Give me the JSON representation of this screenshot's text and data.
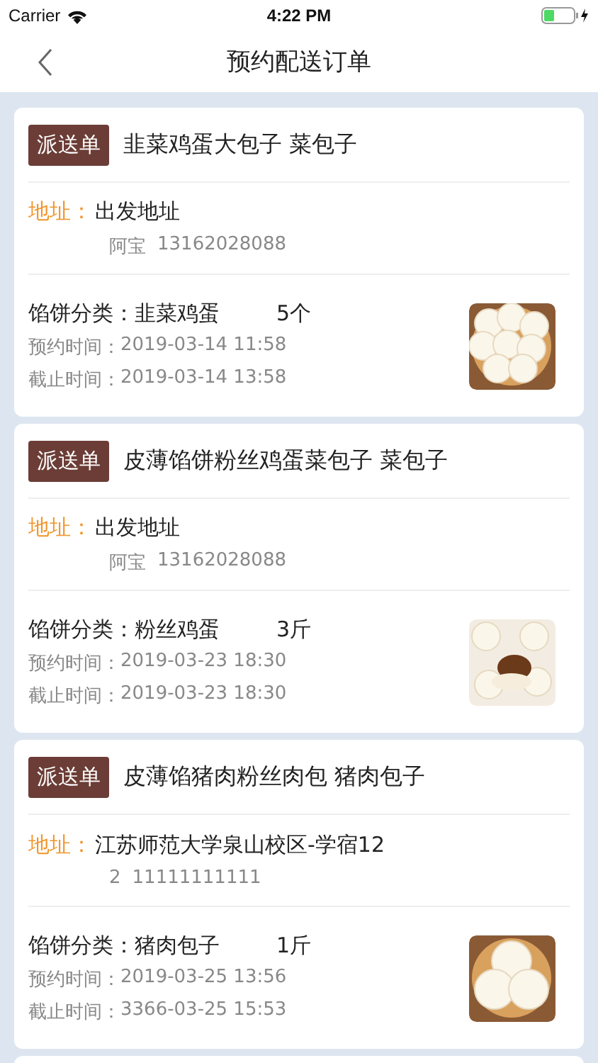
{
  "status_bar": {
    "carrier": "Carrier",
    "time": "4:22 PM"
  },
  "nav": {
    "title": "预约配送订单"
  },
  "orders": [
    {
      "tag": "派送单",
      "title": "韭菜鸡蛋大包子 菜包子",
      "address_label": "地址：",
      "address": "出发地址",
      "contact": "阿宝",
      "phone": "13162028088",
      "filling_label": "馅饼分类：",
      "filling": "韭菜鸡蛋",
      "quantity": "5个",
      "booking_label": "预约时间：",
      "booking_time": "2019-03-14 11:58",
      "deadline_label": "截止时间：",
      "deadline_time": "2019-03-14 13:58"
    },
    {
      "tag": "派送单",
      "title": "皮薄馅饼粉丝鸡蛋菜包子 菜包子",
      "address_label": "地址：",
      "address": "出发地址",
      "contact": "阿宝",
      "phone": "13162028088",
      "filling_label": "馅饼分类：",
      "filling": "粉丝鸡蛋",
      "quantity": "3斤",
      "booking_label": "预约时间：",
      "booking_time": "2019-03-23 18:30",
      "deadline_label": "截止时间：",
      "deadline_time": "2019-03-23 18:30"
    },
    {
      "tag": "派送单",
      "title": "皮薄馅猪肉粉丝肉包 猪肉包子",
      "address_label": "地址：",
      "address": "江苏师范大学泉山校区-学宿12",
      "contact": "2",
      "phone": "11111111111",
      "filling_label": "馅饼分类：",
      "filling": "猪肉包子",
      "quantity": "1斤",
      "booking_label": "预约时间：",
      "booking_time": "2019-03-25 13:56",
      "deadline_label": "截止时间：",
      "deadline_time": "3366-03-25 15:53"
    }
  ]
}
